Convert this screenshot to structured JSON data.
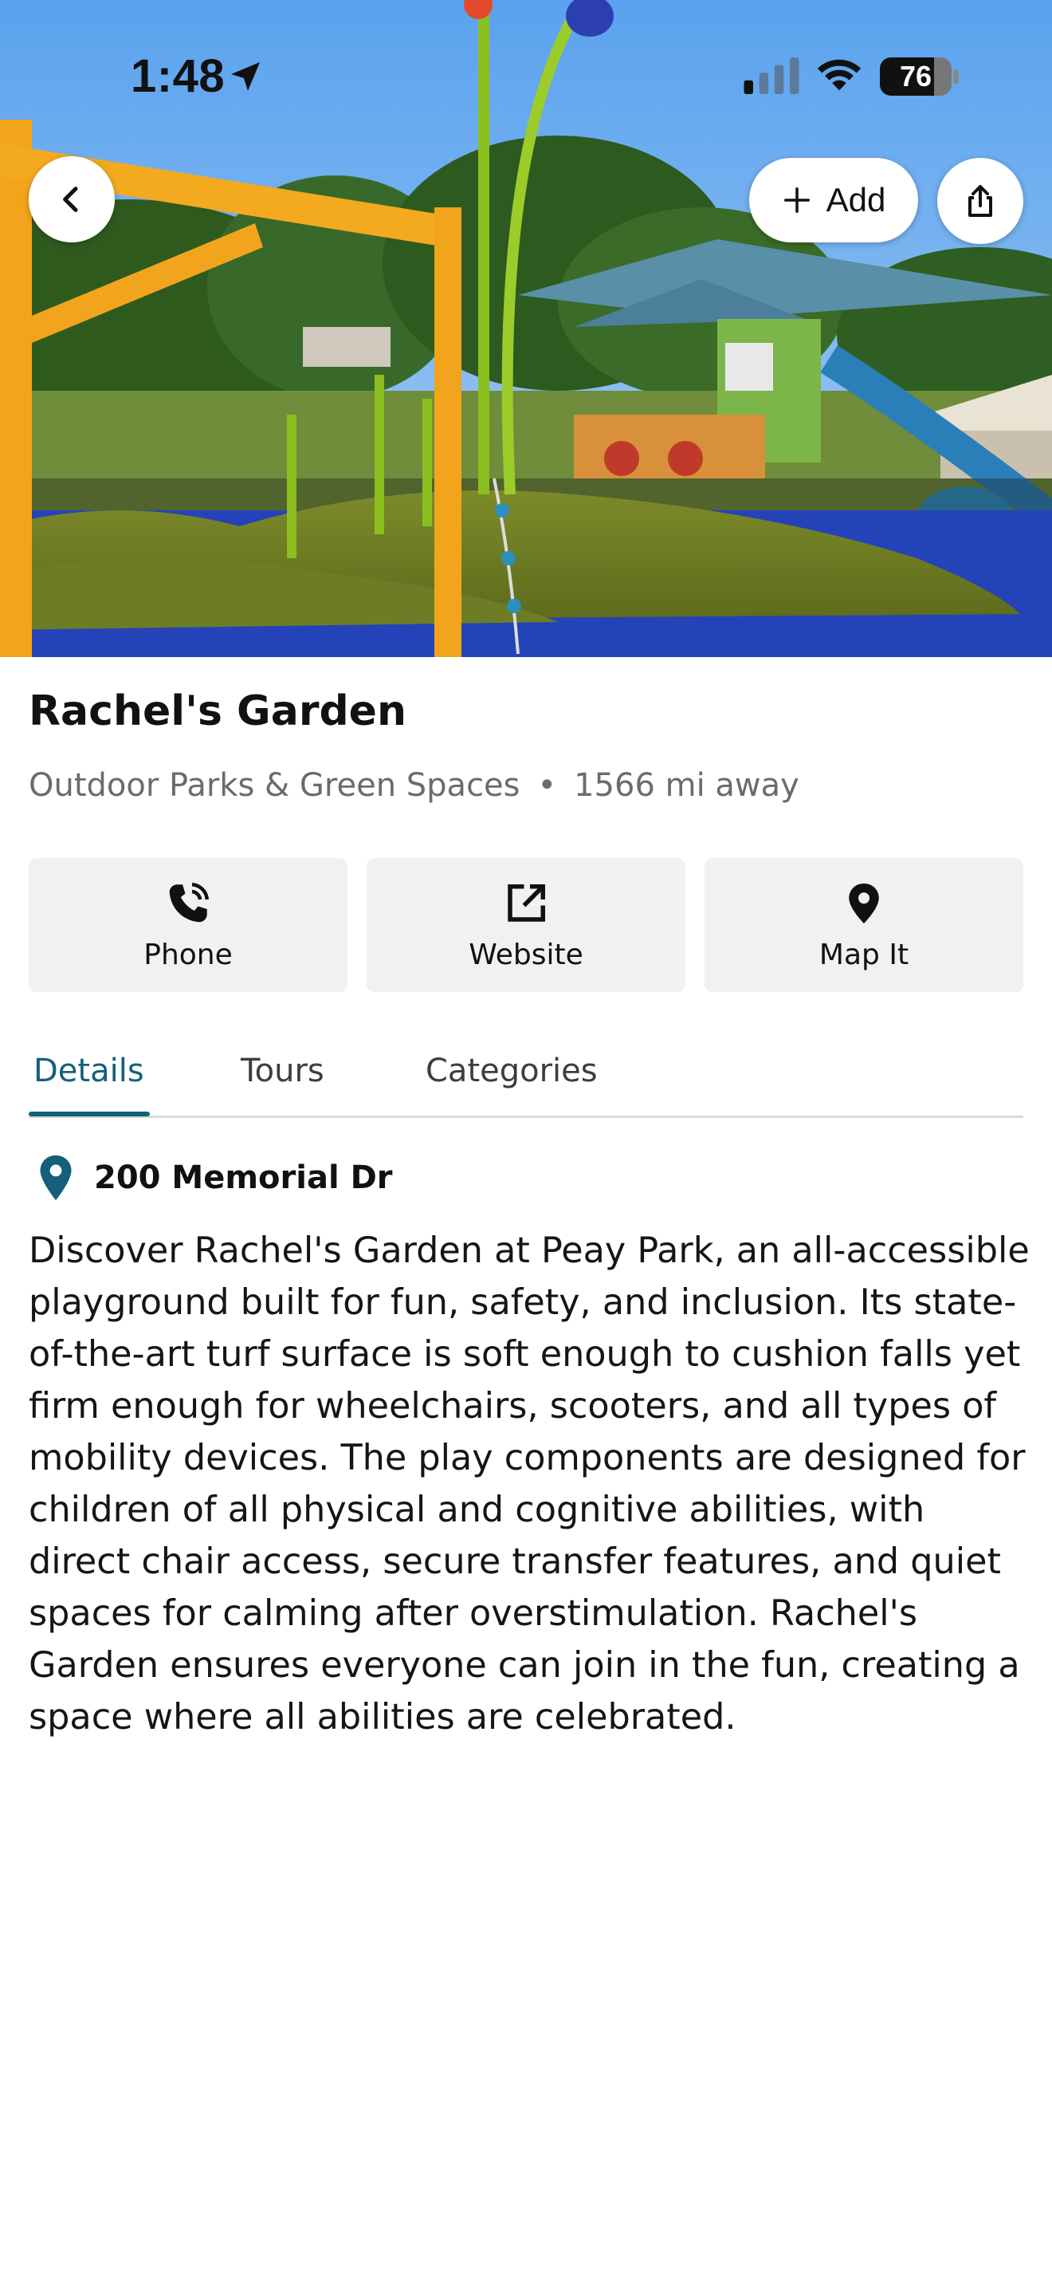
{
  "status_bar": {
    "time": "1:48",
    "battery_percent": "76",
    "battery_level": 0.76
  },
  "header": {
    "add_label": "Add"
  },
  "place": {
    "name": "Rachel's Garden",
    "category": "Outdoor Parks & Green Spaces",
    "separator": "•",
    "distance": "1566 mi away"
  },
  "actions": [
    {
      "label": "Phone",
      "icon": "phone-icon"
    },
    {
      "label": "Website",
      "icon": "external-link-icon"
    },
    {
      "label": "Map It",
      "icon": "map-pin-icon"
    }
  ],
  "tabs": [
    {
      "label": "Details",
      "active": true
    },
    {
      "label": "Tours",
      "active": false
    },
    {
      "label": "Categories",
      "active": false
    }
  ],
  "details": {
    "address": "200 Memorial Dr",
    "description": "Discover Rachel's Garden at Peay Park, an all-accessible playground built for fun, safety, and inclusion. Its state-of-the-art turf surface is soft enough to cushion falls yet firm enough for wheelchairs, scooters, and all types of mobility devices. The play components are designed for children of all physical and cognitive abilities, with direct chair access, secure transfer features, and quiet spaces for calming after overstimulation. Rachel's Garden ensures everyone can join in the fun, creating a space where all abilities are celebrated."
  },
  "colors": {
    "accent": "#14607a",
    "button_bg": "#f0f1f2",
    "muted_text": "#6b6b6b"
  }
}
